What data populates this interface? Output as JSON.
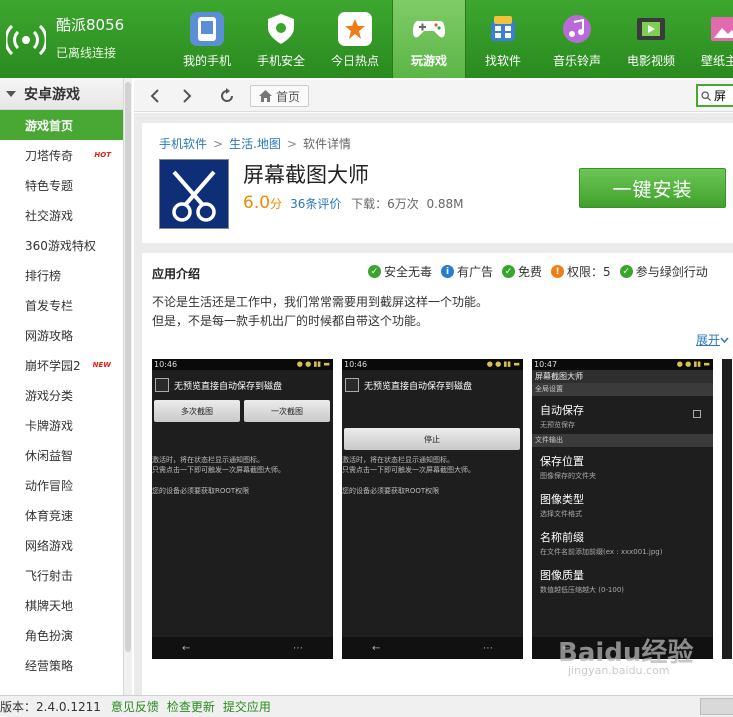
{
  "brand": {
    "name": "酷派8056",
    "status": "已离线连接"
  },
  "nav": [
    {
      "label": "我的手机",
      "icon": "phone-icon"
    },
    {
      "label": "手机安全",
      "icon": "shield-icon"
    },
    {
      "label": "今日热点",
      "icon": "star-icon"
    },
    {
      "label": "玩游戏",
      "icon": "gamepad-icon",
      "active": true
    },
    {
      "label": "找软件",
      "icon": "apps-icon"
    },
    {
      "label": "音乐铃声",
      "icon": "music-icon"
    },
    {
      "label": "电影视频",
      "icon": "film-icon"
    },
    {
      "label": "壁纸主题",
      "icon": "wallpaper-icon"
    }
  ],
  "sidebar": {
    "title": "安卓游戏",
    "items": [
      {
        "label": "游戏首页",
        "active": true
      },
      {
        "label": "刀塔传奇",
        "tag": "HOT"
      },
      {
        "label": "特色专题"
      },
      {
        "label": "社交游戏"
      },
      {
        "label": "360游戏特权"
      },
      {
        "label": "排行榜"
      },
      {
        "label": "首发专栏"
      },
      {
        "label": "网游攻略"
      },
      {
        "label": "崩坏学园2",
        "tag": "NEW"
      },
      {
        "label": "游戏分类"
      },
      {
        "label": "卡牌游戏"
      },
      {
        "label": "休闲益智"
      },
      {
        "label": "动作冒险"
      },
      {
        "label": "体育竞速"
      },
      {
        "label": "网络游戏"
      },
      {
        "label": "飞行射击"
      },
      {
        "label": "棋牌天地"
      },
      {
        "label": "角色扮演"
      },
      {
        "label": "经营策略"
      }
    ]
  },
  "toolbar": {
    "home_label": "首页",
    "search_value": "屏"
  },
  "breadcrumb": {
    "item1": "手机软件",
    "item2": "生活.地图",
    "current": "软件详情",
    "sep": ">"
  },
  "app": {
    "title": "屏幕截图大师",
    "score": "6.0",
    "score_unit": "分",
    "reviews": "36条评价",
    "downloads": "下载：6万次",
    "size": "0.88M",
    "install_label": "一键安装"
  },
  "intro": {
    "heading": "应用介绍",
    "badges": [
      {
        "label": "安全无毒",
        "color": "#3aa52c",
        "glyph": "✓"
      },
      {
        "label": "有广告",
        "color": "#2a7cd0",
        "glyph": "i"
      },
      {
        "label": "免费",
        "color": "#3aa52c",
        "glyph": "✓"
      },
      {
        "label": "权限：5",
        "color": "#ef7d16",
        "glyph": "!"
      },
      {
        "label": "参与绿剑行动",
        "color": "#3aa52c",
        "glyph": "✓"
      }
    ],
    "line1": "不论是生活还是工作中，我们常常需要用到截屏这样一个功能。",
    "line2": "但是，不是每一款手机出厂的时候都自带这个功能。",
    "expand": "展开"
  },
  "shots": {
    "s1": {
      "time": "10:46",
      "checkbox": "无预览直接自动保存到磁盘",
      "btn_a": "多次截图",
      "btn_b": "一次截图",
      "note1": "激活时，将在状态栏显示通知图标。",
      "note2": "只需点击一下即可触发一次屏幕截图大师。",
      "note3": "您的设备必须要获取ROOT权限"
    },
    "s2": {
      "time": "10:46",
      "checkbox": "无预览直接自动保存到磁盘",
      "btn_stop": "停止",
      "note1": "激活时，将在状态栏显示通知图标。",
      "note2": "只需点击一下即可触发一次屏幕截图大师。",
      "note3": "您的设备必须要获取ROOT权限"
    },
    "s3": {
      "time": "10:47",
      "title": "屏幕截图大师",
      "cat1": "全局设置",
      "cat2": "文件输出",
      "items": [
        {
          "t": "自动保存",
          "s": "无预览保存"
        },
        {
          "t": "保存位置",
          "s": "图像保存的文件夹"
        },
        {
          "t": "图像类型",
          "s": "选择文件格式"
        },
        {
          "t": "名称前缀",
          "s": "在文件名前添加前缀(ex : xxx001.jpg)"
        },
        {
          "t": "图像质量",
          "s": "数值越低压缩越大 (0-100)"
        }
      ]
    }
  },
  "watermark": {
    "main": "Baidu经验",
    "sub": "jingyan.baidu.com"
  },
  "bottom": {
    "version": "版本：2.4.0.1211",
    "feedback": "意见反馈",
    "update": "检查更新",
    "submit": "提交应用"
  }
}
